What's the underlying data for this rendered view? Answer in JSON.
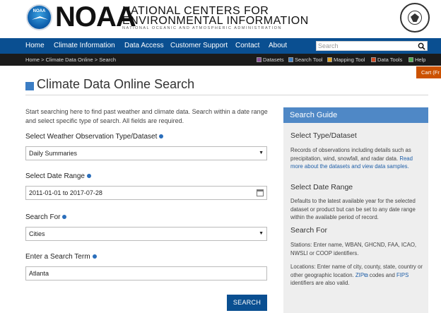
{
  "header": {
    "logo_text": "NOAA",
    "wordmark": "NOAA",
    "org_line1": "NATIONAL CENTERS FOR",
    "org_line2": "ENVIRONMENTAL INFORMATION",
    "org_line3": "NATIONAL OCEANIC AND ATMOSPHERIC ADMINISTRATION"
  },
  "nav": {
    "items": [
      "Home",
      "Climate Information",
      "Data Access",
      "Customer Support",
      "Contact",
      "About"
    ],
    "search_placeholder": "Search"
  },
  "breadcrumb": {
    "home": "Home",
    "sep1": " > ",
    "cdo": "Climate Data Online",
    "sep2": " > ",
    "current": "Search"
  },
  "tools": [
    {
      "label": "Datasets",
      "color": "#8a4f9a"
    },
    {
      "label": "Search Tool",
      "color": "#3b7dc4"
    },
    {
      "label": "Mapping Tool",
      "color": "#e0a21d"
    },
    {
      "label": "Data Tools",
      "color": "#d0471f"
    },
    {
      "label": "Help",
      "color": "#4caf50"
    }
  ],
  "cart": {
    "label": "Cart (Fr"
  },
  "page": {
    "title": "Climate Data Online Search"
  },
  "form": {
    "intro": "Start searching here to find past weather and climate data. Search within a date range and select specific type of search. All fields are required.",
    "dataset_label": "Select Weather Observation Type/Dataset",
    "dataset_value": "Daily Summaries",
    "date_label": "Select Date Range",
    "date_value": "2011-01-01 to 2017-07-28",
    "searchfor_label": "Search For",
    "searchfor_value": "Cities",
    "term_label": "Enter a Search Term",
    "term_value": "Atlanta",
    "submit_label": "SEARCH"
  },
  "guide": {
    "title": "Search Guide",
    "s1_heading": "Select Type/Dataset",
    "s1_text": "Records of observations including details such as precipitation, wind, snowfall, and radar data.",
    "s1_link": "Read more about the datasets and view data samples.",
    "s2_heading": "Select Date Range",
    "s2_text": "Defaults to the latest available year for the selected dataset or product but can be set to any date range within the available period of record.",
    "s3_heading": "Search For",
    "s3_text1": "Stations: Enter name, WBAN, GHCND, FAA, ICAO, NWSLI or COOP identifiers.",
    "s3_text2a": "Locations: Enter name of city, county, state, country or other geographic location.",
    "s3_zip": "ZIP",
    "s3_text2b": "codes and",
    "s3_fips": "FIPS",
    "s3_text2c": "identifiers are also valid."
  }
}
